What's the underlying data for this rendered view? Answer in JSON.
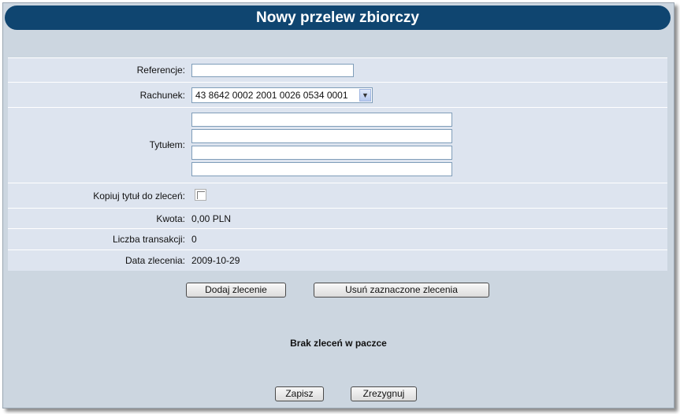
{
  "window": {
    "title": "Nowy przelew zbiorczy"
  },
  "form": {
    "referencje_label": "Referencje:",
    "referencje_value": "",
    "rachunek_label": "Rachunek:",
    "rachunek_selected": "43 8642 0002 2001 0026 0534 0001",
    "tytulem_label": "Tytułem:",
    "tytulem_lines": [
      "",
      "",
      "",
      ""
    ],
    "kopiuj_label": "Kopiuj tytuł do zleceń:",
    "kopiuj_checked": false,
    "kwota_label": "Kwota:",
    "kwota_value": "0,00 PLN",
    "liczba_label": "Liczba transakcji:",
    "liczba_value": "0",
    "data_label": "Data zlecenia:",
    "data_value": "2009-10-29"
  },
  "actions": {
    "add_order": "Dodaj zlecenie",
    "remove_selected": "Usuń zaznaczone zlecenia"
  },
  "orders": {
    "empty_message": "Brak zleceń w paczce"
  },
  "footer": {
    "save": "Zapisz",
    "cancel": "Zrezygnuj"
  },
  "colors": {
    "title_bar": "#0f4570",
    "panel_background": "#ccd6e0",
    "form_background": "#dde4ef"
  },
  "icons": {
    "dropdown": "chevron-down-icon"
  }
}
